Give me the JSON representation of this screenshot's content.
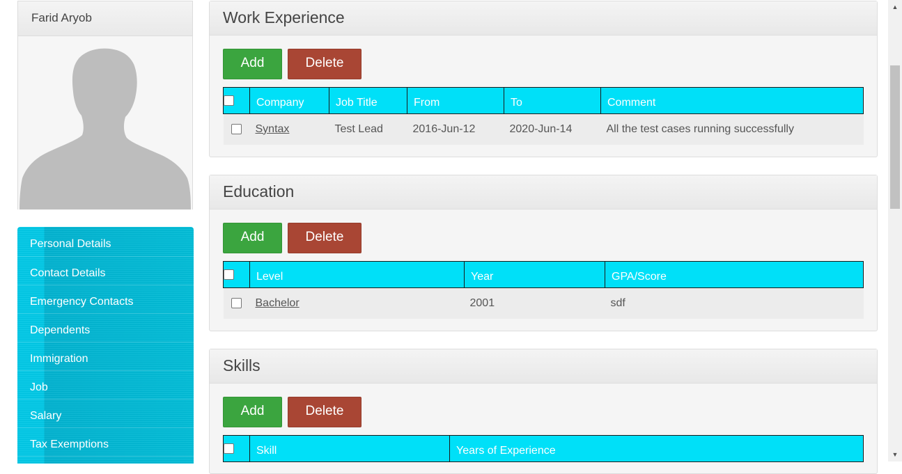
{
  "profile": {
    "name": "Farid Aryob"
  },
  "side_menu": {
    "items": [
      "Personal Details",
      "Contact Details",
      "Emergency Contacts",
      "Dependents",
      "Immigration",
      "Job",
      "Salary",
      "Tax Exemptions"
    ]
  },
  "work_experience": {
    "title": "Work Experience",
    "add_label": "Add",
    "delete_label": "Delete",
    "columns": [
      "Company",
      "Job Title",
      "From",
      "To",
      "Comment"
    ],
    "rows": [
      {
        "company": "Syntax",
        "job_title": "Test Lead",
        "from": "2016-Jun-12",
        "to": "2020-Jun-14",
        "comment": "All the test cases running successfully"
      }
    ]
  },
  "education": {
    "title": "Education",
    "add_label": "Add",
    "delete_label": "Delete",
    "columns": [
      "Level",
      "Year",
      "GPA/Score"
    ],
    "rows": [
      {
        "level": "Bachelor",
        "year": "2001",
        "gpa": "sdf"
      }
    ]
  },
  "skills": {
    "title": "Skills",
    "add_label": "Add",
    "delete_label": "Delete",
    "columns": [
      "Skill",
      "Years of Experience"
    ]
  },
  "colors": {
    "table_header": "#00e0f8",
    "side_menu": "#00bcd7",
    "add_button": "#3ba53f",
    "delete_button": "#a94634"
  },
  "icons": {
    "avatar": "person-silhouette-icon",
    "scroll_up": "triangle-up-icon",
    "scroll_down": "triangle-down-icon"
  }
}
